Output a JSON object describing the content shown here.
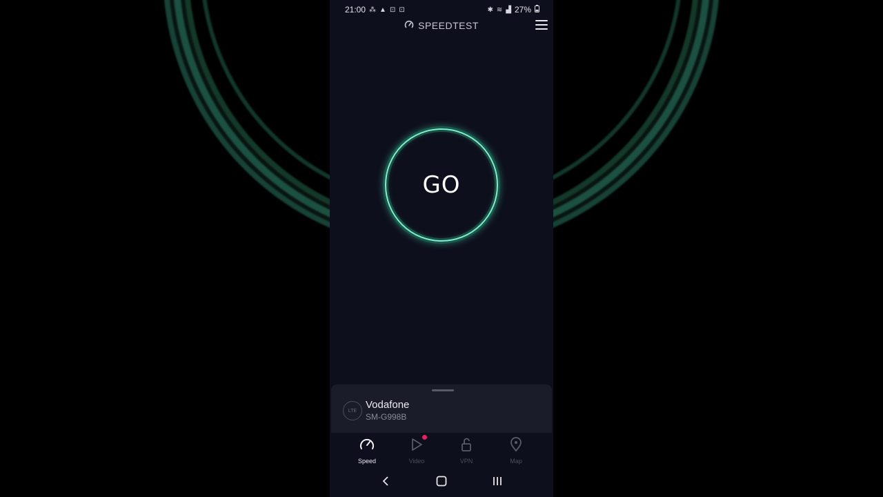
{
  "status_bar": {
    "time": "21:00",
    "battery": "27%"
  },
  "app_bar": {
    "title": "SPEEDTEST"
  },
  "main": {
    "go_label": "GO"
  },
  "connection": {
    "network_badge": "LTE",
    "provider": "Vodafone",
    "device": "SM-G998B"
  },
  "tabs": [
    {
      "label": "Speed",
      "icon": "speedometer-icon",
      "active": true
    },
    {
      "label": "Video",
      "icon": "play-icon",
      "active": false,
      "badge": true
    },
    {
      "label": "VPN",
      "icon": "lock-icon",
      "active": false
    },
    {
      "label": "Map",
      "icon": "map-pin-icon",
      "active": false
    }
  ],
  "colors": {
    "background": "#0e0f1c",
    "accent": "#5fe3bf",
    "badge": "#ea1f66",
    "sheet": "#1b1c29"
  }
}
